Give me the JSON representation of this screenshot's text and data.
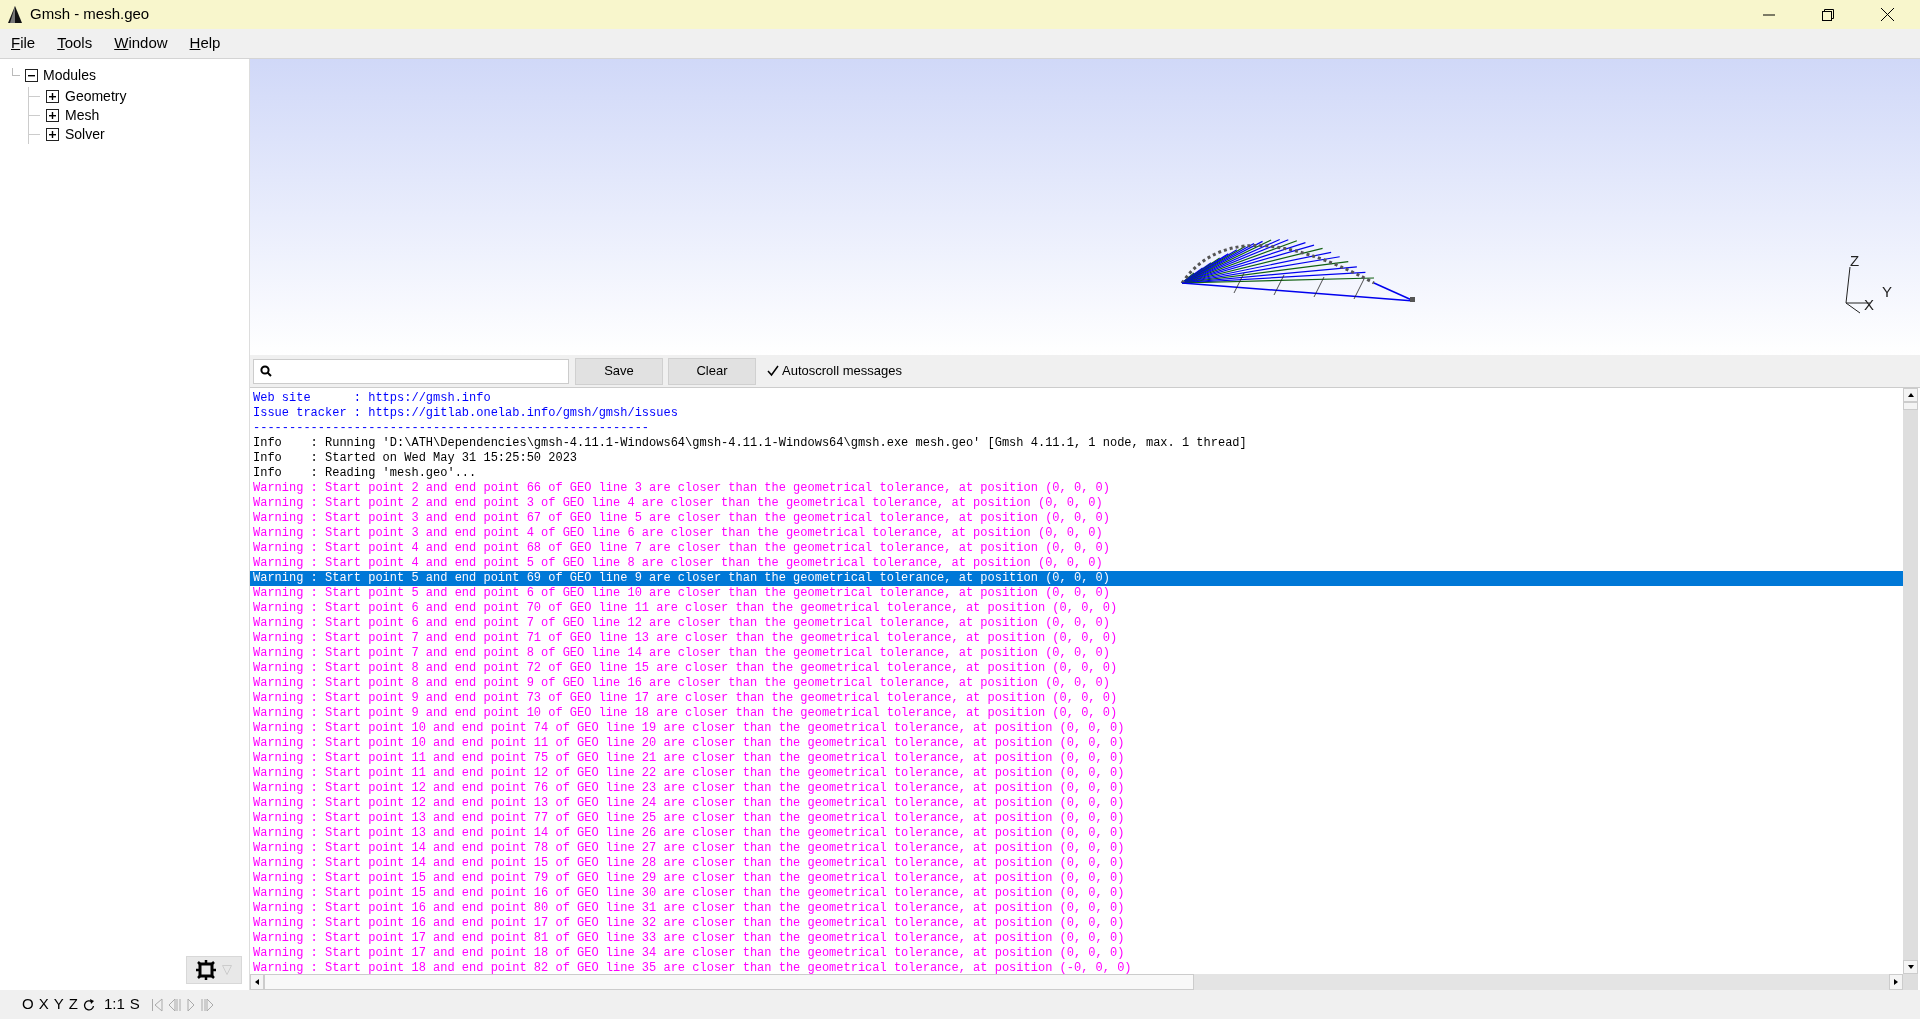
{
  "window": {
    "title": "Gmsh - mesh.geo"
  },
  "menu": [
    "File",
    "Tools",
    "Window",
    "Help"
  ],
  "tree": {
    "label": "Modules",
    "expanded": true,
    "children": [
      {
        "label": "Geometry",
        "expanded": false
      },
      {
        "label": "Mesh",
        "expanded": false
      },
      {
        "label": "Solver",
        "expanded": false
      }
    ]
  },
  "axes": {
    "z": "Z",
    "y": "Y",
    "x": "X"
  },
  "message_toolbar": {
    "save": "Save",
    "clear": "Clear",
    "autoscroll": {
      "label": "Autoscroll messages",
      "checked": true
    }
  },
  "log": [
    {
      "kind": "link",
      "text": "Web site      : https://gmsh.info",
      "selected": false
    },
    {
      "kind": "link",
      "text": "Issue tracker : https://gitlab.onelab.info/gmsh/gmsh/issues",
      "selected": false
    },
    {
      "kind": "link",
      "text": "-------------------------------------------------------",
      "selected": false
    },
    {
      "kind": "info",
      "text": "Info    : Running 'D:\\ATH\\Dependencies\\gmsh-4.11.1-Windows64\\gmsh-4.11.1-Windows64\\gmsh.exe mesh.geo' [Gmsh 4.11.1, 1 node, max. 1 thread]",
      "selected": false
    },
    {
      "kind": "info",
      "text": "Info    : Started on Wed May 31 15:25:50 2023",
      "selected": false
    },
    {
      "kind": "info",
      "text": "Info    : Reading 'mesh.geo'...",
      "selected": false
    },
    {
      "kind": "warning",
      "text": "Warning : Start point 2 and end point 66 of GEO line 3 are closer than the geometrical tolerance, at position (0, 0, 0)",
      "selected": false
    },
    {
      "kind": "warning",
      "text": "Warning : Start point 2 and end point 3 of GEO line 4 are closer than the geometrical tolerance, at position (0, 0, 0)",
      "selected": false
    },
    {
      "kind": "warning",
      "text": "Warning : Start point 3 and end point 67 of GEO line 5 are closer than the geometrical tolerance, at position (0, 0, 0)",
      "selected": false
    },
    {
      "kind": "warning",
      "text": "Warning : Start point 3 and end point 4 of GEO line 6 are closer than the geometrical tolerance, at position (0, 0, 0)",
      "selected": false
    },
    {
      "kind": "warning",
      "text": "Warning : Start point 4 and end point 68 of GEO line 7 are closer than the geometrical tolerance, at position (0, 0, 0)",
      "selected": false
    },
    {
      "kind": "warning",
      "text": "Warning : Start point 4 and end point 5 of GEO line 8 are closer than the geometrical tolerance, at position (0, 0, 0)",
      "selected": false
    },
    {
      "kind": "warning",
      "text": "Warning : Start point 5 and end point 69 of GEO line 9 are closer than the geometrical tolerance, at position (0, 0, 0)",
      "selected": true
    },
    {
      "kind": "warning",
      "text": "Warning : Start point 5 and end point 6 of GEO line 10 are closer than the geometrical tolerance, at position (0, 0, 0)",
      "selected": false
    },
    {
      "kind": "warning",
      "text": "Warning : Start point 6 and end point 70 of GEO line 11 are closer than the geometrical tolerance, at position (0, 0, 0)",
      "selected": false
    },
    {
      "kind": "warning",
      "text": "Warning : Start point 6 and end point 7 of GEO line 12 are closer than the geometrical tolerance, at position (0, 0, 0)",
      "selected": false
    },
    {
      "kind": "warning",
      "text": "Warning : Start point 7 and end point 71 of GEO line 13 are closer than the geometrical tolerance, at position (0, 0, 0)",
      "selected": false
    },
    {
      "kind": "warning",
      "text": "Warning : Start point 7 and end point 8 of GEO line 14 are closer than the geometrical tolerance, at position (0, 0, 0)",
      "selected": false
    },
    {
      "kind": "warning",
      "text": "Warning : Start point 8 and end point 72 of GEO line 15 are closer than the geometrical tolerance, at position (0, 0, 0)",
      "selected": false
    },
    {
      "kind": "warning",
      "text": "Warning : Start point 8 and end point 9 of GEO line 16 are closer than the geometrical tolerance, at position (0, 0, 0)",
      "selected": false
    },
    {
      "kind": "warning",
      "text": "Warning : Start point 9 and end point 73 of GEO line 17 are closer than the geometrical tolerance, at position (0, 0, 0)",
      "selected": false
    },
    {
      "kind": "warning",
      "text": "Warning : Start point 9 and end point 10 of GEO line 18 are closer than the geometrical tolerance, at position (0, 0, 0)",
      "selected": false
    },
    {
      "kind": "warning",
      "text": "Warning : Start point 10 and end point 74 of GEO line 19 are closer than the geometrical tolerance, at position (0, 0, 0)",
      "selected": false
    },
    {
      "kind": "warning",
      "text": "Warning : Start point 10 and end point 11 of GEO line 20 are closer than the geometrical tolerance, at position (0, 0, 0)",
      "selected": false
    },
    {
      "kind": "warning",
      "text": "Warning : Start point 11 and end point 75 of GEO line 21 are closer than the geometrical tolerance, at position (0, 0, 0)",
      "selected": false
    },
    {
      "kind": "warning",
      "text": "Warning : Start point 11 and end point 12 of GEO line 22 are closer than the geometrical tolerance, at position (0, 0, 0)",
      "selected": false
    },
    {
      "kind": "warning",
      "text": "Warning : Start point 12 and end point 76 of GEO line 23 are closer than the geometrical tolerance, at position (0, 0, 0)",
      "selected": false
    },
    {
      "kind": "warning",
      "text": "Warning : Start point 12 and end point 13 of GEO line 24 are closer than the geometrical tolerance, at position (0, 0, 0)",
      "selected": false
    },
    {
      "kind": "warning",
      "text": "Warning : Start point 13 and end point 77 of GEO line 25 are closer than the geometrical tolerance, at position (0, 0, 0)",
      "selected": false
    },
    {
      "kind": "warning",
      "text": "Warning : Start point 13 and end point 14 of GEO line 26 are closer than the geometrical tolerance, at position (0, 0, 0)",
      "selected": false
    },
    {
      "kind": "warning",
      "text": "Warning : Start point 14 and end point 78 of GEO line 27 are closer than the geometrical tolerance, at position (0, 0, 0)",
      "selected": false
    },
    {
      "kind": "warning",
      "text": "Warning : Start point 14 and end point 15 of GEO line 28 are closer than the geometrical tolerance, at position (0, 0, 0)",
      "selected": false
    },
    {
      "kind": "warning",
      "text": "Warning : Start point 15 and end point 79 of GEO line 29 are closer than the geometrical tolerance, at position (0, 0, 0)",
      "selected": false
    },
    {
      "kind": "warning",
      "text": "Warning : Start point 15 and end point 16 of GEO line 30 are closer than the geometrical tolerance, at position (0, 0, 0)",
      "selected": false
    },
    {
      "kind": "warning",
      "text": "Warning : Start point 16 and end point 80 of GEO line 31 are closer than the geometrical tolerance, at position (0, 0, 0)",
      "selected": false
    },
    {
      "kind": "warning",
      "text": "Warning : Start point 16 and end point 17 of GEO line 32 are closer than the geometrical tolerance, at position (0, 0, 0)",
      "selected": false
    },
    {
      "kind": "warning",
      "text": "Warning : Start point 17 and end point 81 of GEO line 33 are closer than the geometrical tolerance, at position (0, 0, 0)",
      "selected": false
    },
    {
      "kind": "warning",
      "text": "Warning : Start point 17 and end point 18 of GEO line 34 are closer than the geometrical tolerance, at position (0, 0, 0)",
      "selected": false
    },
    {
      "kind": "warning",
      "text": "Warning : Start point 18 and end point 82 of GEO line 35 are closer than the geometrical tolerance, at position (-0, 0, 0)",
      "selected": false
    }
  ],
  "status_bar": {
    "buttons": [
      "O",
      "X",
      "Y",
      "Z"
    ],
    "scale": "1:1",
    "s": "S"
  }
}
